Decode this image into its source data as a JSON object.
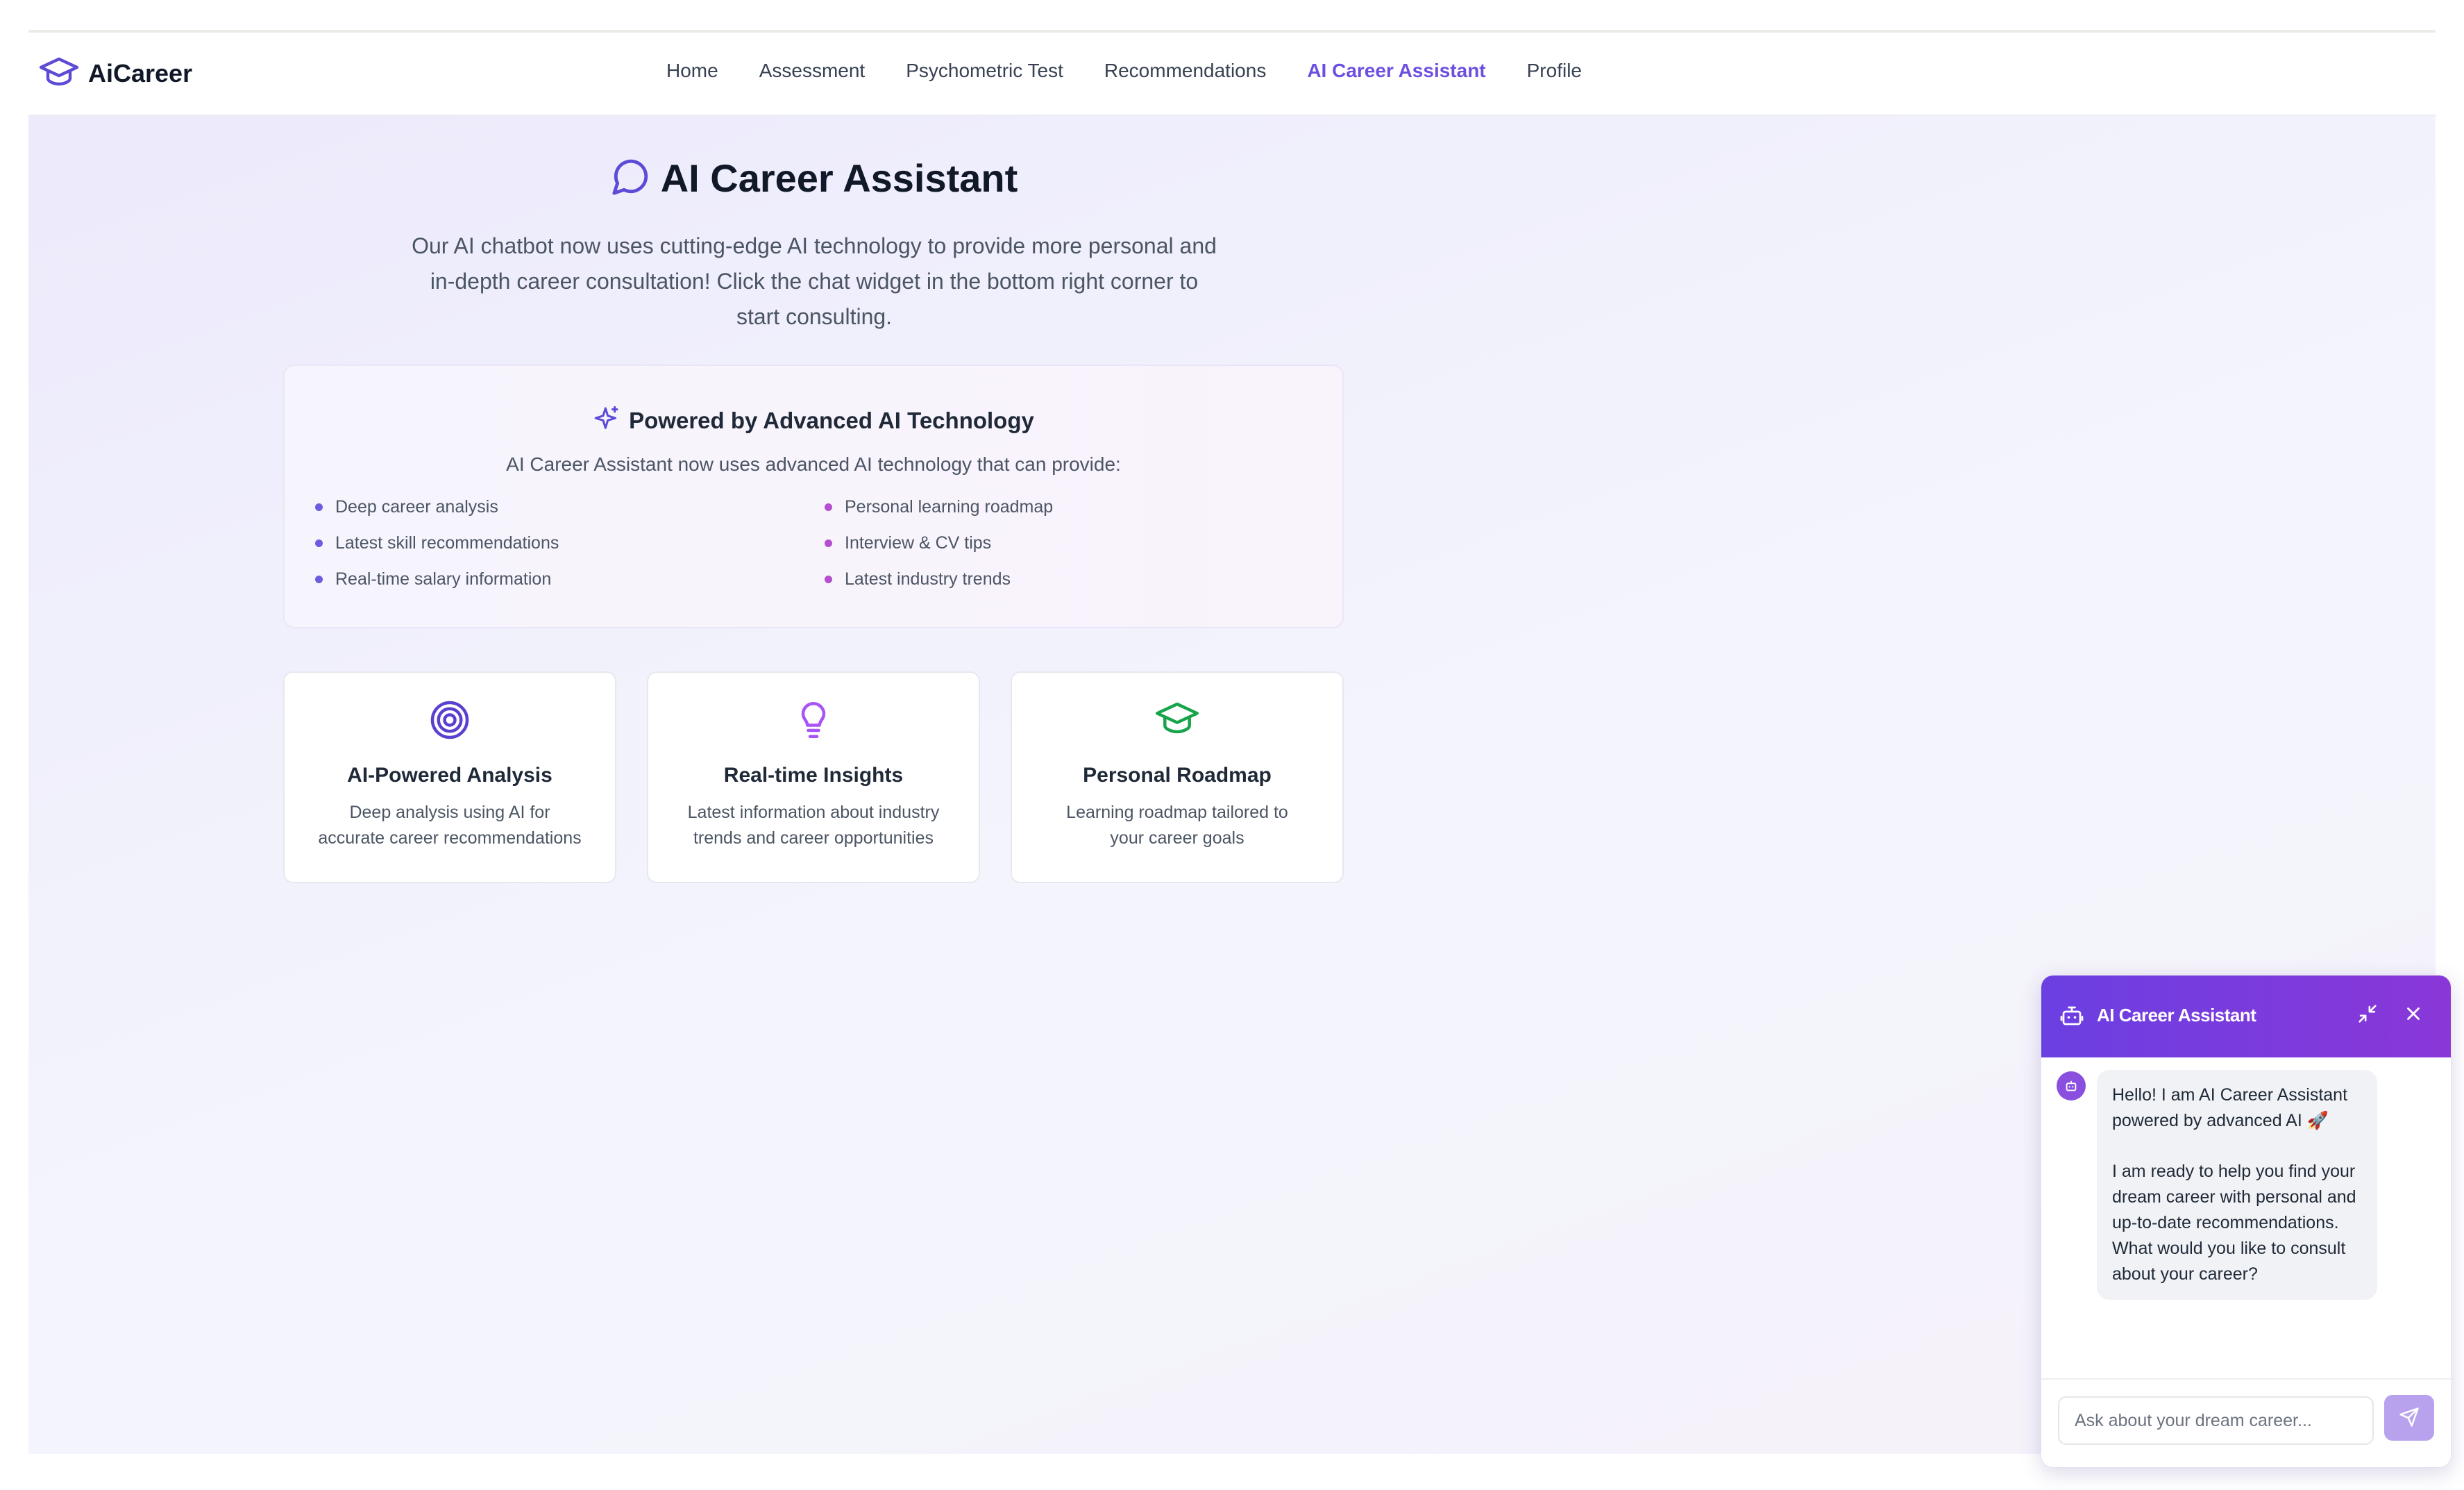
{
  "brand": {
    "name": "AiCareer",
    "icon": "graduation-cap-icon"
  },
  "nav": {
    "items": [
      {
        "label": "Home"
      },
      {
        "label": "Assessment"
      },
      {
        "label": "Psychometric Test"
      },
      {
        "label": "Recommendations"
      },
      {
        "label": "AI Career Assistant",
        "active": true
      },
      {
        "label": "Profile"
      }
    ]
  },
  "hero": {
    "icon": "message-circle-icon",
    "title": "AI Career Assistant",
    "description_lines": [
      "Our AI chatbot now uses cutting-edge AI technology to provide more personal and",
      "in-depth career consultation! Click the chat widget in the bottom right corner to",
      "start consulting."
    ]
  },
  "powered": {
    "icon": "sparkles-icon",
    "title": "Powered by Advanced AI Technology",
    "subtitle": "AI Career Assistant now uses advanced AI technology that can provide:",
    "left_features": [
      "Deep career analysis",
      "Latest skill recommendations",
      "Real-time salary information"
    ],
    "right_features": [
      "Personal learning roadmap",
      "Interview & CV tips",
      "Latest industry trends"
    ]
  },
  "cards": [
    {
      "icon": "target-icon",
      "title": "AI-Powered Analysis",
      "desc_lines": [
        "Deep analysis using AI for",
        "accurate career recommendations"
      ]
    },
    {
      "icon": "lightbulb-icon",
      "title": "Real-time Insights",
      "desc_lines": [
        "Latest information about industry",
        "trends and career opportunities"
      ]
    },
    {
      "icon": "graduation-cap-icon",
      "title": "Personal Roadmap",
      "desc_lines": [
        "Learning roadmap tailored to",
        "your career goals"
      ]
    }
  ],
  "chat": {
    "title": "AI Career Assistant",
    "message_line1": "Hello! I am AI Career Assistant powered by advanced AI 🚀",
    "message_line2": "I am ready to help you find your dream career with personal and up-to-date recommendations. What would you like to consult about your career?",
    "input_placeholder": "Ask about your dream career...",
    "input_value": ""
  },
  "colors": {
    "accent": "#6d4fe0",
    "chat_header_start": "#6b3fe2",
    "chat_header_end": "#8a37d8",
    "bullet_left": "#6b5ce0",
    "bullet_right": "#b44fd0",
    "lightbulb": "#a855f7",
    "cap_green": "#16a34a",
    "send_button": "#b8a2ee"
  }
}
